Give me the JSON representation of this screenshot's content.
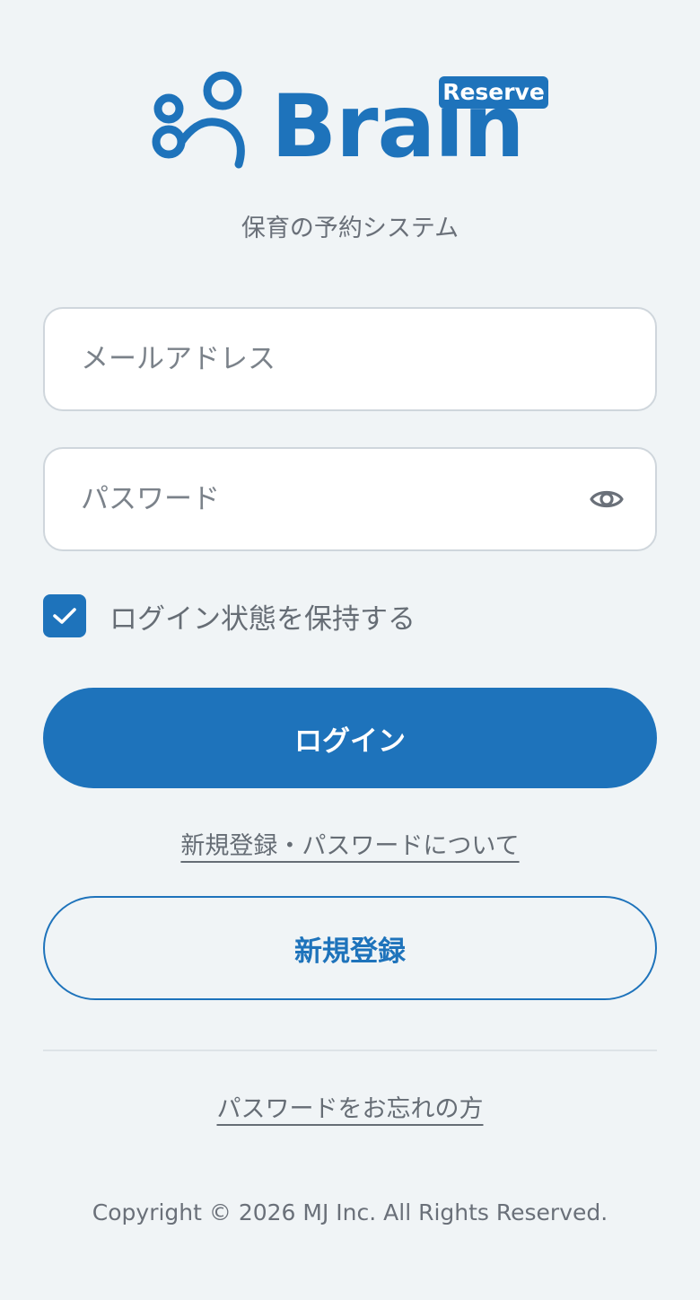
{
  "logo": {
    "wordmark": "Brain",
    "badge": "Reserve",
    "brand_color": "#1e73bb"
  },
  "subtitle": "保育の予約システム",
  "form": {
    "email_placeholder": "メールアドレス",
    "email_value": "",
    "password_placeholder": "パスワード",
    "password_value": "",
    "password_toggle_icon": "eye-icon",
    "remember_label": "ログイン状態を保持する",
    "remember_checked": true,
    "login_label": "ログイン"
  },
  "links": {
    "about": "新規登録・パスワードについて",
    "register": "新規登録",
    "forgot": "パスワードをお忘れの方"
  },
  "footer": {
    "copyright": "Copyright © 2026 MJ Inc. All Rights Reserved."
  }
}
